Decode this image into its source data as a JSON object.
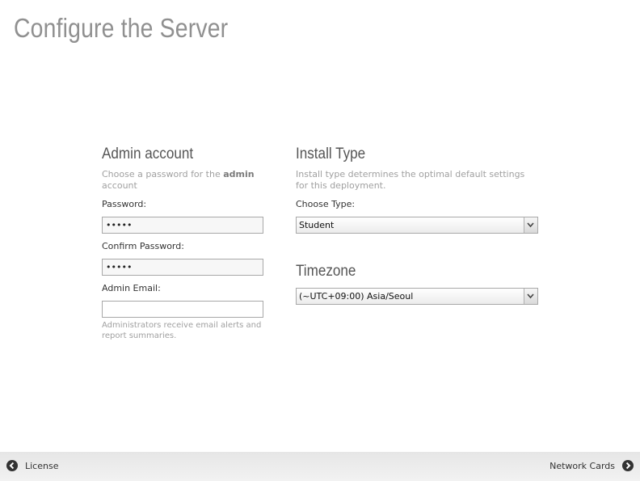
{
  "page": {
    "title": "Configure the Server"
  },
  "admin": {
    "title": "Admin account",
    "desc_prefix": "Choose a password for the",
    "desc_bold": "admin",
    "desc_suffix": "account",
    "password_label": "Password:",
    "password_value": "•••••",
    "confirm_label": "Confirm Password:",
    "confirm_value": "•••••",
    "email_label": "Admin Email:",
    "email_value": "",
    "email_hint": "Administrators receive email alerts and report summaries."
  },
  "install": {
    "title": "Install Type",
    "desc": "Install type determines the optimal default settings for this deployment.",
    "type_label": "Choose Type:",
    "type_value": "Student"
  },
  "timezone": {
    "title": "Timezone",
    "value": "(~UTC+09:00) Asia/Seoul"
  },
  "footer": {
    "prev_label": "License",
    "next_label": "Network Cards",
    "prev_icon": "arrow-left-circle-icon",
    "next_icon": "arrow-right-circle-icon"
  }
}
